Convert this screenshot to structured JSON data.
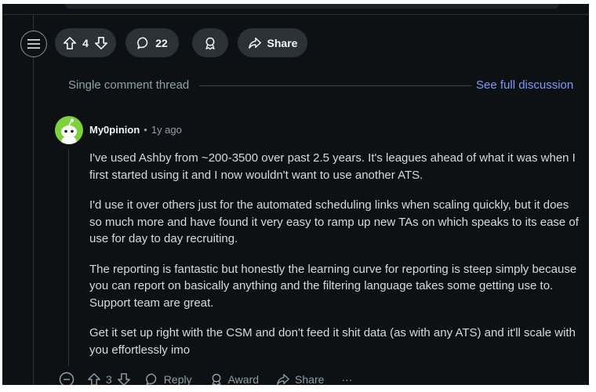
{
  "post_actions": {
    "upvote_count": "4",
    "comment_count": "22",
    "share_label": "Share"
  },
  "thread": {
    "label": "Single comment thread",
    "see_full_label": "See full discussion"
  },
  "comment": {
    "author": "My0pinion",
    "separator": "•",
    "age": "1y ago",
    "paragraphs": [
      "I've used Ashby from ~200-3500 over past 2.5 years. It's leagues ahead of what it was when I first started using it and I now wouldn't want to use another ATS.",
      "I'd use it over others just for the automated scheduling links when scaling quickly, but it does so much more and have found it very easy to ramp up new TAs on which speaks to its ease of use for day to day recruiting.",
      "The reporting is fantastic but honestly the learning curve for reporting is steep simply because you can report on basically anything and the filtering language takes some getting use to. Support team are great.",
      "Get it set up right with the CSM and don't feed it shit data (as with any ATS) and it'll scale with you effortlessly imo"
    ],
    "actions": {
      "vote_count": "3",
      "reply_label": "Reply",
      "award_label": "Award",
      "share_label": "Share",
      "more_label": "···"
    }
  },
  "colors": {
    "background": "#0e1113",
    "pill": "#2a3236",
    "link": "#8097ff",
    "avatar": "#7fd13b"
  }
}
